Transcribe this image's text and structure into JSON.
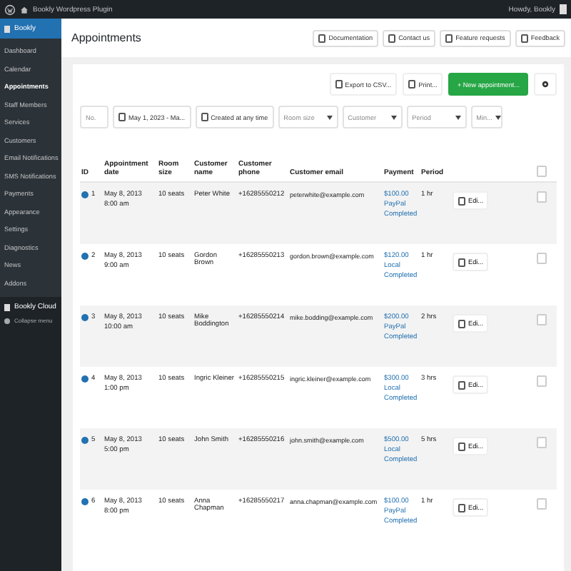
{
  "admin_bar": {
    "site": "Bookly Wordpress Plugin",
    "greeting": "Howdy, Bookly"
  },
  "sidebar": {
    "menu": {
      "label": "Bookly",
      "selected": true
    },
    "items": [
      {
        "label": "Dashboard",
        "selected": false
      },
      {
        "label": "Calendar",
        "selected": false
      },
      {
        "label": "Appointments",
        "selected": true
      },
      {
        "label": "Staff Members",
        "selected": false
      },
      {
        "label": "Services",
        "selected": false
      },
      {
        "label": "Customers",
        "selected": false
      },
      {
        "label": "Email Notifications",
        "selected": false
      },
      {
        "label": "SMS Notifications",
        "selected": false
      },
      {
        "label": "Payments",
        "selected": false
      },
      {
        "label": "Appearance",
        "selected": false
      },
      {
        "label": "Settings",
        "selected": false
      },
      {
        "label": "Diagnostics",
        "selected": false
      },
      {
        "label": "News",
        "selected": false
      },
      {
        "label": "Addons",
        "selected": false
      }
    ],
    "cloud": "Bookly Cloud",
    "collapse": "Collapse menu"
  },
  "page": {
    "title": "Appointments",
    "help_buttons": [
      "Documentation",
      "Contact us",
      "Feature requests",
      "Feedback"
    ]
  },
  "toolbar": {
    "export": "Export to CSV...",
    "print": "Print...",
    "new": "+ New appointment..."
  },
  "filters": {
    "id_placeholder": "No.",
    "date_range": "May 1, 2023 - Ma...",
    "created": "Created at any time",
    "selects": [
      "Room size",
      "Customer",
      "Period",
      "Min..."
    ]
  },
  "table": {
    "select_all_checked": false,
    "columns": [
      "ID",
      "Appointment date",
      "Room size",
      "Customer name",
      "Customer phone",
      "Customer email",
      "Payment",
      "Period"
    ],
    "rows": [
      {
        "id": "1",
        "date": "May 8, 2013",
        "time": "8:00 am",
        "size": "10 seats",
        "name": "Peter White",
        "phone": "+16285550212",
        "email": "peterwhite@example.com",
        "amount": "$100.00",
        "method": "PayPal",
        "status": "Completed",
        "period": "1 hr",
        "edit": "Edi...",
        "checked": false
      },
      {
        "id": "2",
        "date": "May 8, 2013",
        "time": "9:00 am",
        "size": "10 seats",
        "name": "Gordon Brown",
        "phone": "+16285550213",
        "email": "gordon.brown@example.com",
        "amount": "$120.00",
        "method": "Local",
        "status": "Completed",
        "period": "1 hr",
        "edit": "Edi...",
        "checked": false
      },
      {
        "id": "3",
        "date": "May 8, 2013",
        "time": "10:00 am",
        "size": "10 seats",
        "name": "Mike Boddington",
        "phone": "+16285550214",
        "email": "mike.bodding@example.com",
        "amount": "$200.00",
        "method": "PayPal",
        "status": "Completed",
        "period": "2 hrs",
        "edit": "Edi...",
        "checked": false
      },
      {
        "id": "4",
        "date": "May 8, 2013",
        "time": "1:00 pm",
        "size": "10 seats",
        "name": "Ingric Kleiner",
        "phone": "+16285550215",
        "email": "ingric.kleiner@example.com",
        "amount": "$300.00",
        "method": "Local",
        "status": "Completed",
        "period": "3 hrs",
        "edit": "Edi...",
        "checked": false
      },
      {
        "id": "5",
        "date": "May 8, 2013",
        "time": "5:00 pm",
        "size": "10 seats",
        "name": "John Smith",
        "phone": "+16285550216",
        "email": "john.smith@example.com",
        "amount": "$500.00",
        "method": "Local",
        "status": "Completed",
        "period": "5 hrs",
        "edit": "Edi...",
        "checked": false
      },
      {
        "id": "6",
        "date": "May 8, 2013",
        "time": "8:00 pm",
        "size": "10 seats",
        "name": "Anna Chapman",
        "phone": "+16285550217",
        "email": "anna.chapman@example.com",
        "amount": "$100.00",
        "method": "PayPal",
        "status": "Completed",
        "period": "1 hr",
        "edit": "Edi...",
        "checked": false
      }
    ]
  }
}
